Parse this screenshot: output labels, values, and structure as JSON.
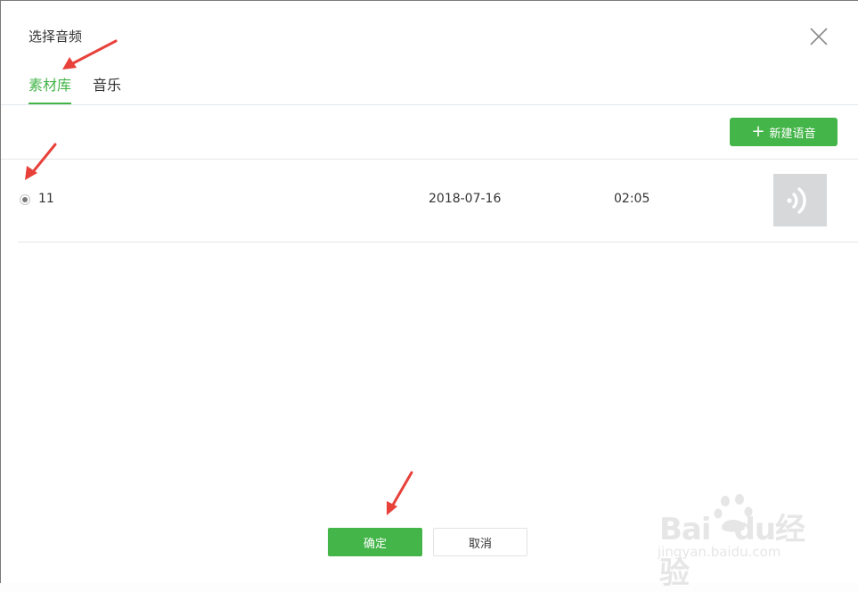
{
  "dialog": {
    "title": "选择音频"
  },
  "tabs": [
    {
      "label": "素材库",
      "active": true
    },
    {
      "label": "音乐",
      "active": false
    }
  ],
  "toolbar": {
    "new_voice_label": "新建语音",
    "new_voice_icon": "plus-icon"
  },
  "list": {
    "rows": [
      {
        "name": "11",
        "date": "2018-07-16",
        "duration": "02:05",
        "selected": true,
        "thumb_icon": "audio-wave-icon"
      }
    ]
  },
  "footer": {
    "confirm_label": "确定",
    "cancel_label": "取消"
  },
  "watermark": {
    "brand": "Baidu经验",
    "url": "jingyan.baidu.com"
  },
  "colors": {
    "accent": "#44b549",
    "annotation_arrow": "#e8413a",
    "thumb_bg": "#d6d8da"
  }
}
